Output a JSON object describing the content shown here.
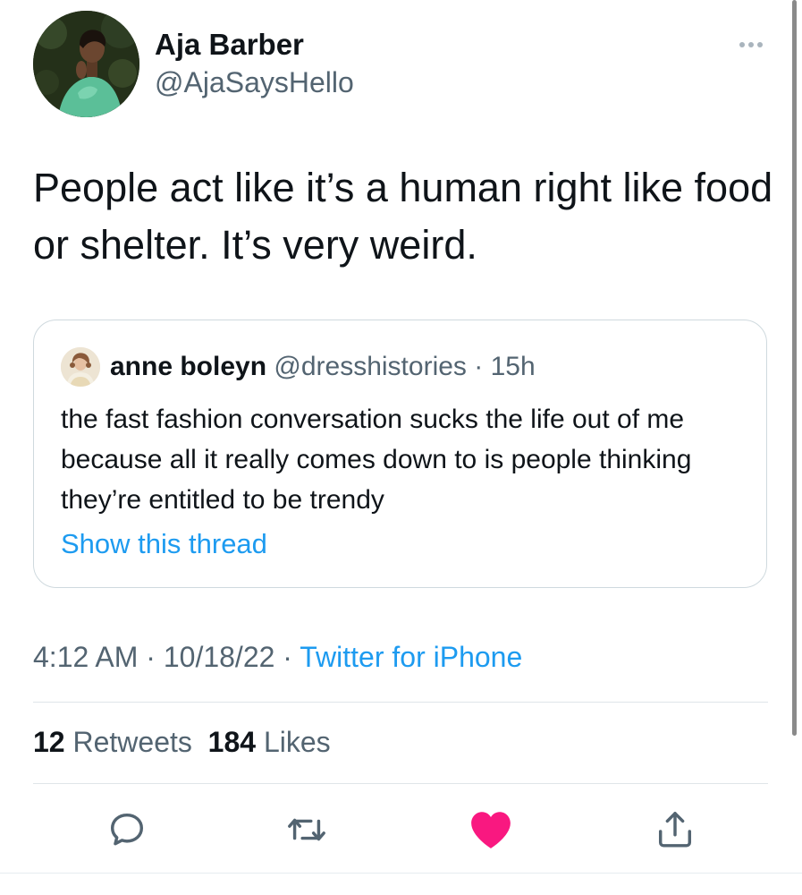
{
  "author": {
    "name": "Aja Barber",
    "handle": "@AjaSaysHello"
  },
  "tweet": {
    "text": "People act like it’s a human right like food or shelter.  It’s very weird."
  },
  "quote": {
    "name": "anne boleyn",
    "handle": "@dresshistories",
    "separator": " · ",
    "time": "15h",
    "text": "the fast fashion conversation sucks the life out of me because all it really comes down to is people thinking they’re entitled to be trendy",
    "link": "Show this thread"
  },
  "meta": {
    "time": "4:12 AM",
    "separator": " · ",
    "date": "10/18/22",
    "source": "Twitter for iPhone"
  },
  "stats": {
    "retweets_count": "12",
    "retweets_label": "Retweets",
    "likes_count": "184",
    "likes_label": "Likes"
  },
  "actions": {
    "reply_icon": "reply-icon",
    "retweet_icon": "retweet-icon",
    "like_icon": "heart-icon",
    "share_icon": "share-icon"
  },
  "colors": {
    "text": "#0f1419",
    "secondary": "#536471",
    "link": "#1d9bf0",
    "like_active": "#f91880",
    "border": "#cfd9de"
  }
}
